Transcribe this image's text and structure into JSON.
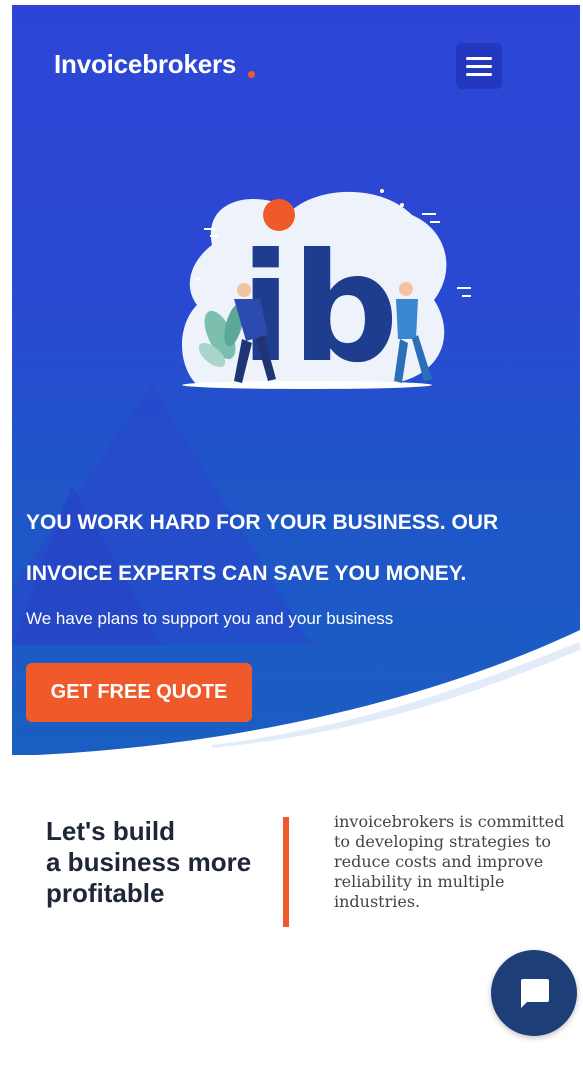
{
  "header": {
    "logo_text": "Invoicebrokers",
    "logo_dot_color": "#f05a28",
    "menu_icon": "hamburger-menu-icon"
  },
  "hero": {
    "illustration_letters": "ib",
    "headline_line1": "YOU WORK HARD FOR YOUR BUSINESS. OUR",
    "headline_line2": "INVOICE EXPERTS CAN SAVE YOU MONEY.",
    "subline": "We have plans to support you and your business",
    "cta_label": "GET FREE QUOTE",
    "cta_color": "#f05a2a"
  },
  "intro": {
    "tagline_line1": "Let's build",
    "tagline_line2": "a business more",
    "tagline_line3": "profitable",
    "description": "invoicebrokers is committed to developing strategies to reduce costs and improve reliability in multiple industries."
  },
  "chat": {
    "icon": "chat-bubble-icon",
    "color": "#1e3e78"
  }
}
